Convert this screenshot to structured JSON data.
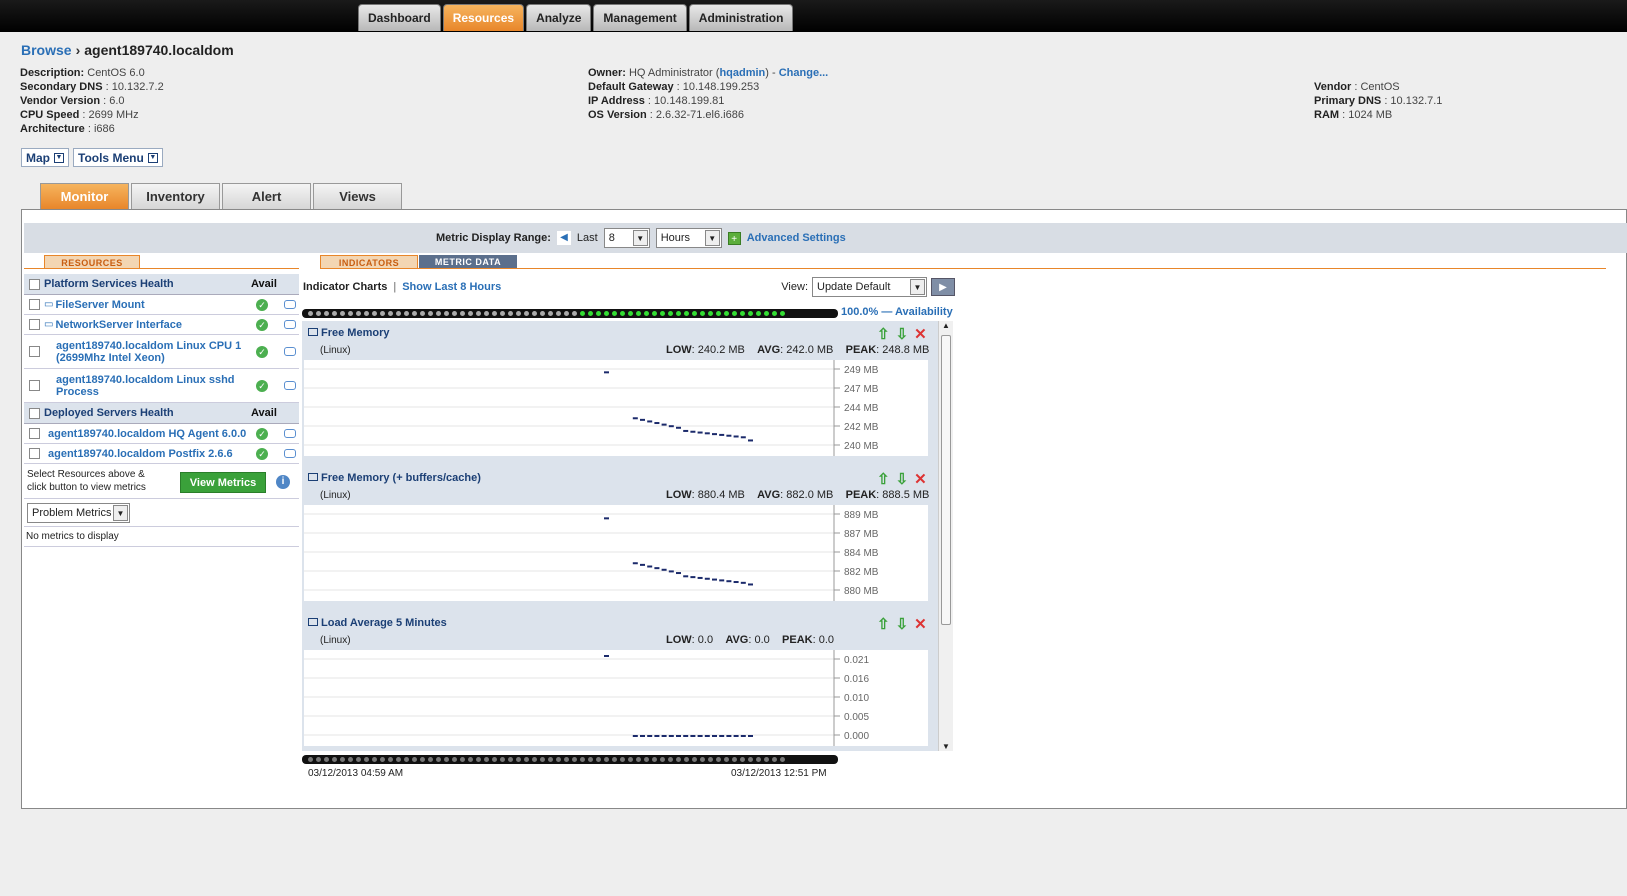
{
  "nav": {
    "tabs": [
      {
        "label": "Dashboard"
      },
      {
        "label": "Resources"
      },
      {
        "label": "Analyze"
      },
      {
        "label": "Management"
      },
      {
        "label": "Administration"
      }
    ],
    "active_tab": "Resources"
  },
  "breadcrumb": {
    "root": "Browse",
    "current": "agent189740.localdom"
  },
  "props": {
    "col1": [
      {
        "label": "Description:",
        "value": " CentOS 6.0"
      },
      {
        "label": "Secondary DNS",
        "value": " : 10.132.7.2"
      },
      {
        "label": "Vendor Version",
        "value": " : 6.0"
      },
      {
        "label": "CPU Speed",
        "value": " : 2699 MHz"
      },
      {
        "label": "Architecture",
        "value": " : i686"
      }
    ],
    "owner": {
      "label": "Owner:",
      "value": " HQ Administrator (",
      "user": "hqadmin",
      "close": ") - ",
      "change": "Change..."
    },
    "col2": [
      {
        "label": "Default Gateway",
        "value": " : 10.148.199.253"
      },
      {
        "label": "IP Address",
        "value": " : 10.148.199.81"
      },
      {
        "label": "OS Version",
        "value": " : 2.6.32-71.el6.i686"
      }
    ],
    "col3": [
      {
        "label": "Vendor",
        "value": " : CentOS"
      },
      {
        "label": "Primary DNS",
        "value": " : 10.132.7.1"
      },
      {
        "label": "RAM",
        "value": " : 1024 MB"
      }
    ]
  },
  "menus": {
    "map": "Map",
    "tools": "Tools Menu"
  },
  "subtabs": [
    "Monitor",
    "Inventory",
    "Alert",
    "Views"
  ],
  "range": {
    "label": "Metric Display Range:",
    "last": "Last",
    "count": "8",
    "unit": "Hours",
    "advanced": "Advanced Settings"
  },
  "left_tabs": {
    "resources": "RESOURCES"
  },
  "right_tabs": {
    "indicators": "INDICATORS",
    "metric_data": "METRIC DATA"
  },
  "resources": {
    "platform_header": "Platform Services Health",
    "avail": "Avail",
    "platform_items": [
      {
        "name": "FileServer Mount"
      },
      {
        "name": "NetworkServer Interface"
      },
      {
        "name": "agent189740.localdom Linux CPU 1 (2699Mhz Intel Xeon)"
      },
      {
        "name": "agent189740.localdom Linux sshd Process"
      }
    ],
    "deployed_header": "Deployed Servers Health",
    "deployed_items": [
      {
        "name": "agent189740.localdom HQ Agent 6.0.0"
      },
      {
        "name": "agent189740.localdom Postfix 2.6.6"
      }
    ],
    "select_hint": "Select Resources above & click button to view metrics",
    "view_metrics": "View Metrics",
    "filter": "Problem Metrics",
    "empty": "No metrics to display"
  },
  "indicators": {
    "title": "Indicator Charts",
    "sep": "|",
    "show_last": "Show Last 8 Hours",
    "view_label": "View:",
    "view_value": "Update Default",
    "availability": "100.0% — Availability",
    "start_time": "03/12/2013 04:59 AM",
    "end_time": "03/12/2013 12:51 PM"
  },
  "chart_data": [
    {
      "type": "scatter",
      "title": "Free Memory",
      "subtitle": "(Linux)",
      "low": "240.2 MB",
      "avg": "242.0 MB",
      "peak": "248.8 MB",
      "ytick_labels": [
        "249 MB",
        "247 MB",
        "244 MB",
        "242 MB",
        "240 MB"
      ],
      "ylim": [
        239.5,
        249.6
      ],
      "values": [
        248.8,
        null,
        null,
        null,
        243.0,
        242.8,
        242.6,
        242.4,
        242.2,
        242.0,
        241.8,
        241.4,
        241.3,
        241.2,
        241.1,
        241.0,
        240.9,
        240.8,
        240.7,
        240.6,
        240.2
      ]
    },
    {
      "type": "scatter",
      "title": "Free Memory (+ buffers/cache)",
      "subtitle": "(Linux)",
      "low": "880.4 MB",
      "avg": "882.0 MB",
      "peak": "888.5 MB",
      "ytick_labels": [
        "889 MB",
        "887 MB",
        "884 MB",
        "882 MB",
        "880 MB"
      ],
      "ylim": [
        879.6,
        889.4
      ],
      "values": [
        888.5,
        null,
        null,
        null,
        883.0,
        882.8,
        882.6,
        882.4,
        882.2,
        882.0,
        881.8,
        881.4,
        881.3,
        881.2,
        881.1,
        881.0,
        880.9,
        880.8,
        880.7,
        880.6,
        880.4
      ]
    },
    {
      "type": "scatter",
      "title": "Load Average 5 Minutes",
      "subtitle": "(Linux)",
      "low": "0.0",
      "avg": "0.0",
      "peak": "0.0",
      "ytick_labels": [
        "0.021",
        "0.016",
        "0.010",
        "0.005",
        "0.000"
      ],
      "ylim": [
        0.0,
        0.021
      ],
      "values": [
        0.021,
        null,
        null,
        null,
        0.0,
        0.0,
        0.0,
        0.0,
        0.0,
        0.0,
        0.0,
        0.0,
        0.0,
        0.0,
        0.0,
        0.0,
        0.0,
        0.0,
        0.0,
        0.0,
        0.0
      ]
    }
  ],
  "labels": {
    "low": "LOW",
    "avg": "AVG",
    "peak": "PEAK"
  },
  "colors": {
    "accent": "#e8862a",
    "link": "#2a6fb6",
    "ok": "#4caf50"
  }
}
